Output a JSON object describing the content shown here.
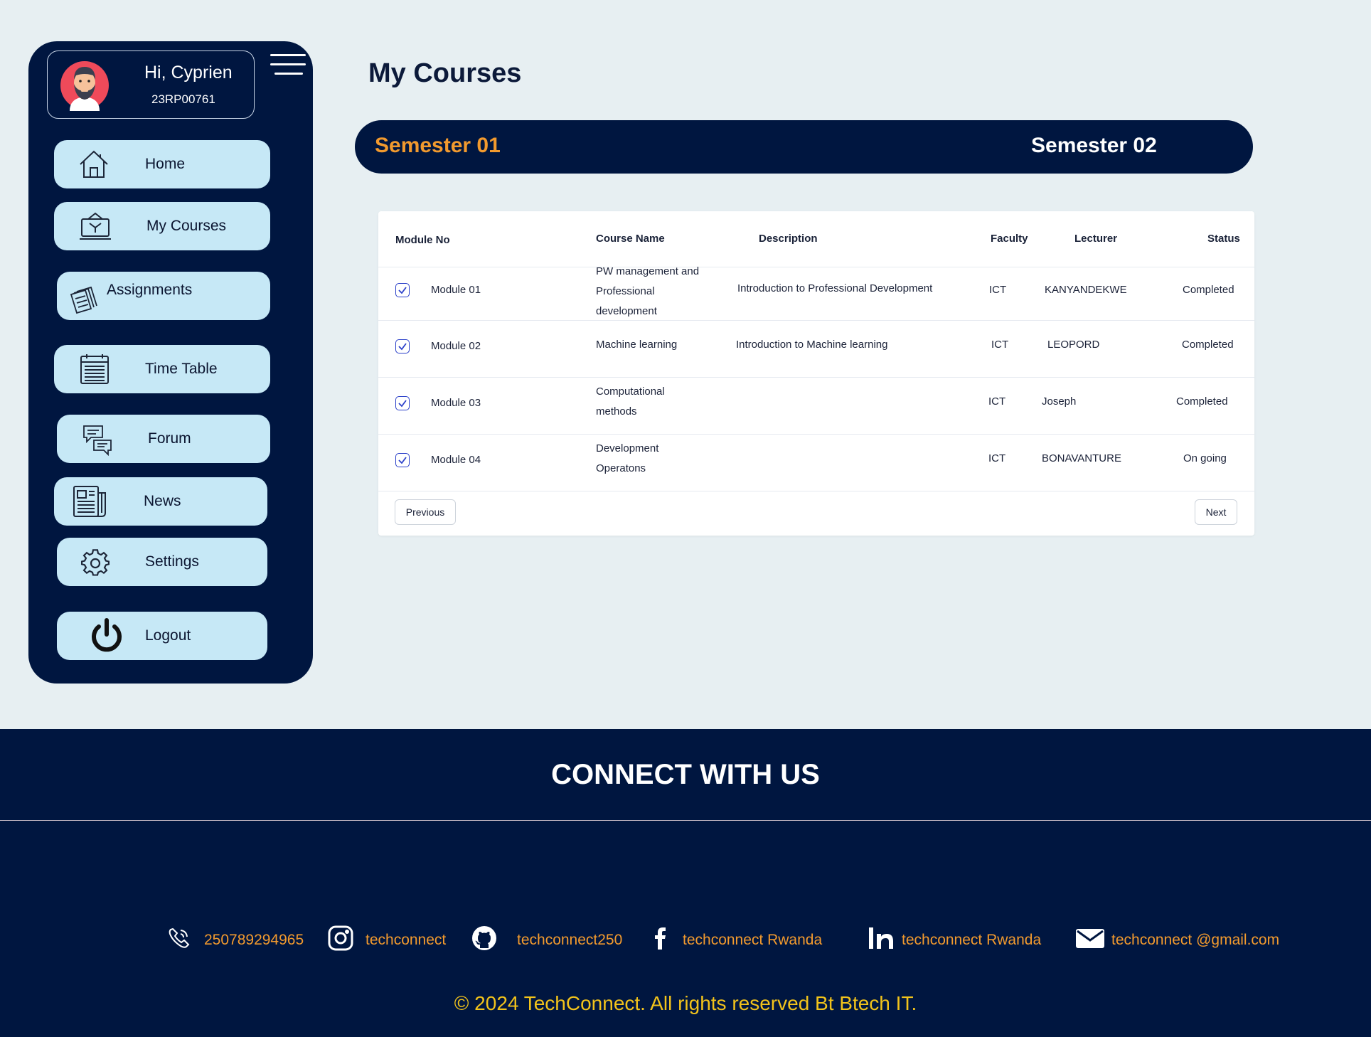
{
  "sidebar": {
    "greeting": "Hi, Cyprien",
    "reg_no": "23RP00761",
    "items": [
      {
        "label": "Home",
        "icon": "home-icon"
      },
      {
        "label": "My Courses",
        "icon": "courses-icon"
      },
      {
        "label": "Assignments",
        "icon": "assignments-icon"
      },
      {
        "label": "Time Table",
        "icon": "calendar-icon"
      },
      {
        "label": "Forum",
        "icon": "forum-icon"
      },
      {
        "label": "News",
        "icon": "news-icon"
      },
      {
        "label": "Settings",
        "icon": "gear-icon"
      },
      {
        "label": "Logout",
        "icon": "power-icon"
      }
    ]
  },
  "main": {
    "title": "My Courses",
    "semesters": [
      "Semester 01",
      "Semester 02"
    ],
    "active_semester_color": "#f29a2e",
    "table": {
      "headers": [
        "Module  No",
        "Course Name",
        "Description",
        "Faculty",
        "Lecturer",
        "Status"
      ],
      "rows": [
        {
          "module": "Module 01",
          "course": [
            "PW management and",
            "Professional",
            "development"
          ],
          "description": "Introduction  to Professional Development",
          "faculty": "ICT",
          "lecturer": "KANYANDEKWE",
          "status": "Completed",
          "checked": true
        },
        {
          "module": "Module 02",
          "course": [
            "Machine learning"
          ],
          "description": "Introduction  to Machine learning",
          "faculty": "ICT",
          "lecturer": "LEOPORD",
          "status": "Completed",
          "checked": true
        },
        {
          "module": "Module 03",
          "course": [
            "Computational",
            "methods"
          ],
          "description": "",
          "faculty": "ICT",
          "lecturer": "Joseph",
          "status": "Completed",
          "checked": true
        },
        {
          "module": "Module 04",
          "course": [
            "Development",
            "Operatons"
          ],
          "description": "",
          "faculty": "ICT",
          "lecturer": "BONAVANTURE",
          "status": "On going",
          "checked": true
        }
      ],
      "prev_label": "Previous",
      "next_label": "Next"
    }
  },
  "footer": {
    "heading": "CONNECT WITH US",
    "contacts": [
      {
        "icon": "phone-icon",
        "text": "250789294965"
      },
      {
        "icon": "instagram-icon",
        "text": "techconnect"
      },
      {
        "icon": "github-icon",
        "text": "techconnect250"
      },
      {
        "icon": "facebook-icon",
        "text": "techconnect Rwanda"
      },
      {
        "icon": "linkedin-icon",
        "text": "techconnect Rwanda"
      },
      {
        "icon": "mail-icon",
        "text": "techconnect @gmail.com"
      }
    ],
    "copyright": "© 2024 TechConnect. All rights reserved Bt Btech IT.",
    "accent_color": "#f29a2e",
    "copyright_color": "#f2c31b",
    "background": "#001640"
  }
}
